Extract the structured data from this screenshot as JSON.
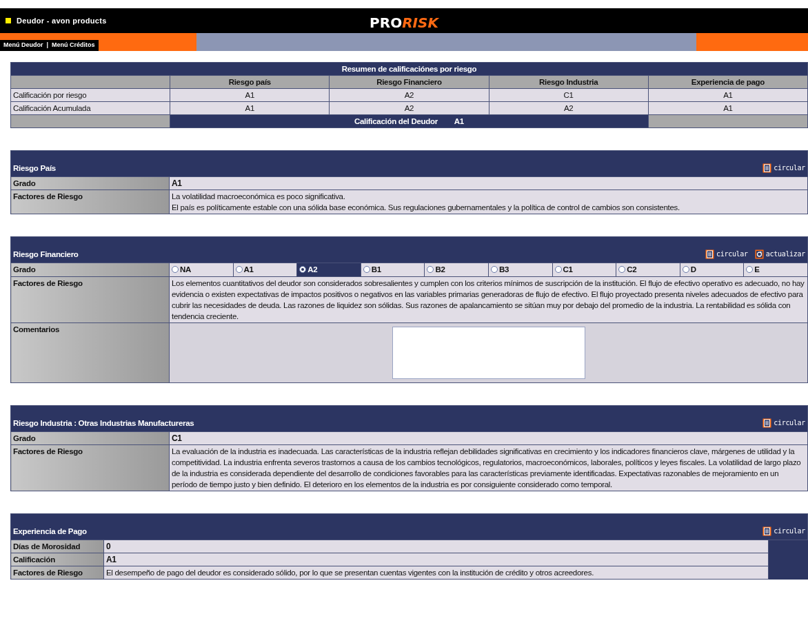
{
  "header": {
    "title": "Deudor - avon products",
    "logo": [
      "PRO",
      "RISK"
    ]
  },
  "nav": {
    "items": [
      "Menú Deudor",
      "Menú Créditos"
    ],
    "separator": "|"
  },
  "summary": {
    "title": "Resumen de calificaciónes por riesgo",
    "columns": [
      "Riesgo país",
      "Riesgo Financiero",
      "Riesgo Industria",
      "Experiencia de pago"
    ],
    "rows": [
      {
        "label": "Calificación por riesgo",
        "values": [
          "A1",
          "A2",
          "C1",
          "A1"
        ]
      },
      {
        "label": "Calificación Acumulada",
        "values": [
          "A1",
          "A2",
          "A2",
          "A1"
        ]
      }
    ],
    "final": {
      "label": "Calificación del Deudor",
      "value": "A1"
    }
  },
  "sections": [
    {
      "title": "Riesgo País",
      "kind": "wide",
      "actions": [
        {
          "kind": "document",
          "label": "circular"
        }
      ],
      "rows": [
        {
          "kind": "grade",
          "label": "Grado",
          "value": "A1"
        },
        {
          "kind": "text",
          "label": "Factores de Riesgo",
          "lines": [
            "La volatilidad macroeconómica es poco significativa.",
            "El país es políticamente estable con una sólida base económica. Sus regulaciones gubernamentales y la política de control de cambios son consistentes."
          ]
        }
      ]
    },
    {
      "title": "Riesgo Financiero",
      "kind": "wide",
      "actions": [
        {
          "kind": "document",
          "label": "circular"
        },
        {
          "kind": "refresh",
          "label": "actualizar"
        }
      ],
      "rows": [
        {
          "kind": "radio",
          "label": "Grado",
          "options": [
            {
              "label": "NA",
              "selected": false
            },
            {
              "label": "A1",
              "selected": false
            },
            {
              "label": "A2",
              "selected": true
            },
            {
              "label": "B1",
              "selected": false
            },
            {
              "label": "B2",
              "selected": false
            },
            {
              "label": "B3",
              "selected": false
            },
            {
              "label": "C1",
              "selected": false
            },
            {
              "label": "C2",
              "selected": false
            },
            {
              "label": "D",
              "selected": false
            },
            {
              "label": "E",
              "selected": false
            }
          ]
        },
        {
          "kind": "text",
          "label": "Factores de Riesgo",
          "lines": [
            "Los elementos cuantitativos del deudor son considerados sobresalientes y cumplen con los criterios mínimos de suscripción de la institución. El flujo de efectivo operativo es adecuado, no hay evidencia o existen expectativas de impactos positivos o negativos en las variables primarias generadoras de flujo de efectivo. El flujo proyectado presenta niveles adecuados de efectivo para cubrir las necesidades de deuda. Las razones de liquidez son sólidas. Sus razones de apalancamiento se sitúan muy por debajo del promedio de la industria. La rentabilidad es sólida con tendencia creciente."
          ]
        },
        {
          "kind": "textarea",
          "label": "Comentarios"
        }
      ]
    },
    {
      "title": "Riesgo Industria : Otras Industrias Manufactureras",
      "kind": "wide",
      "actions": [
        {
          "kind": "document",
          "label": "circular"
        }
      ],
      "rows": [
        {
          "kind": "grade",
          "label": "Grado",
          "value": "C1"
        },
        {
          "kind": "text",
          "label": "Factores de Riesgo",
          "lines": [
            "La evaluación de la industria es inadecuada. Las características de la industria reflejan debilidades significativas en crecimiento y los indicadores financieros clave, márgenes de utilidad y la competitividad. La industria enfrenta severos trastornos a causa de los cambios tecnológicos, regulatorios, macroeconómicos, laborales, políticos y leyes fiscales. La volatilidad de largo plazo de la industria es considerada dependiente del desarrollo de condiciones favorables para las características previamente identificadas. Expectativas razonables de mejoramiento en un período de tiempo justo y bien definido. El deterioro en los elementos de la industria es por consiguiente considerado como temporal."
          ]
        }
      ]
    },
    {
      "title": "Experiencia de Pago",
      "kind": "compact",
      "actions": [
        {
          "kind": "document",
          "label": "circular"
        }
      ],
      "rows": [
        {
          "kind": "grade",
          "label": "Días de Morosidad",
          "value": "0"
        },
        {
          "kind": "grade",
          "label": "Calificación",
          "value": "A1"
        },
        {
          "kind": "text",
          "label": "Factores de Riesgo",
          "lines": [
            "El desempeño de pago del deudor es considerado sólido, por lo que se presentan cuentas vigentes con la institución de crédito y otros acreedores."
          ]
        }
      ]
    }
  ]
}
